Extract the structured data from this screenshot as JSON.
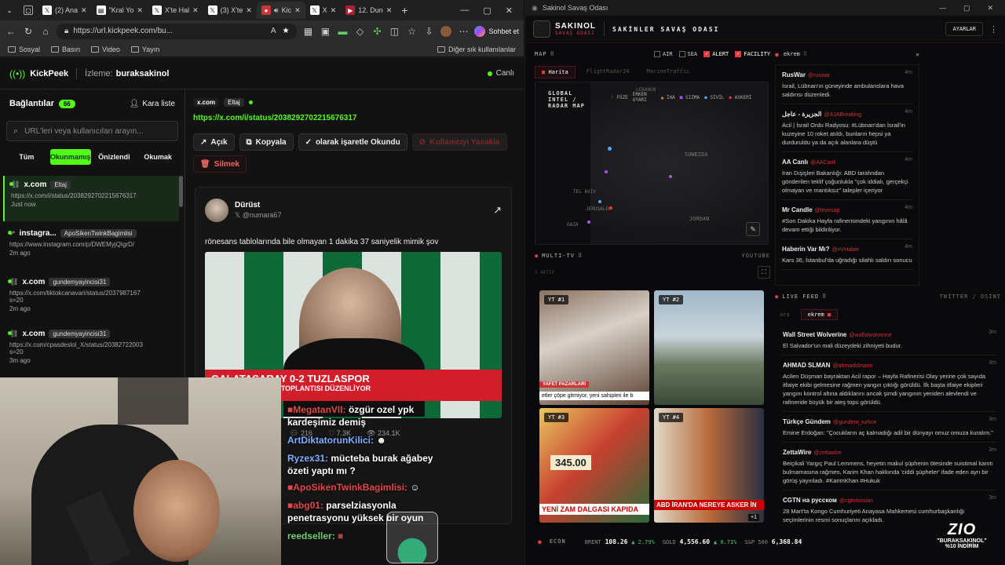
{
  "browser": {
    "tabs": [
      {
        "title": "",
        "icon": "chevron"
      },
      {
        "title": "",
        "icon": "tab-actions"
      },
      {
        "title": "(2) Ana",
        "icon": "x"
      },
      {
        "title": "\"Kral Yo",
        "icon": "page"
      },
      {
        "title": "X'te Hal",
        "icon": "x"
      },
      {
        "title": "(3) X'te",
        "icon": "x"
      },
      {
        "title": "Kic",
        "icon": "kick"
      },
      {
        "title": "X",
        "icon": "x"
      },
      {
        "title": "12. Dun",
        "icon": "media"
      }
    ],
    "url": "https://url.kickpeek.com/bu...",
    "chat_button": "Sohbet et",
    "bookmarks": [
      "Sosyal",
      "Basın",
      "Video",
      "Yayın"
    ],
    "other_bookmarks": "Diğer sık kullanılanlar"
  },
  "kickpeek": {
    "brand": "KickPeek",
    "watching_label": "İzleme:",
    "watching_user": "buraksakinol",
    "live": "Canlı",
    "connections_label": "Bağlantılar",
    "connections_count": "66",
    "blacklist": "Kara liste",
    "search_placeholder": "URL'leri veya kullanıcıları arayın...",
    "filters": [
      "Tüm",
      "Okunmamış",
      "Önizlendi",
      "Okumak"
    ],
    "active_filter": 1,
    "items": [
      {
        "site": "x.com",
        "user": "Eltaj",
        "url": "https://x.com/i/status/2038292702215676317",
        "time": "Just now"
      },
      {
        "site": "instagra...",
        "user": "ApoSikenTwinkBagimlisi",
        "url": "https://www.instagram.com/p/DWEMyjQIgrD/",
        "time": "2m ago"
      },
      {
        "site": "x.com",
        "user": "gundemyayincisi31",
        "url": "https://x.com/tiktokcanavari/status/2037987167\ns=20",
        "time": "2m ago"
      },
      {
        "site": "x.com",
        "user": "gundemyayincisi31",
        "url": "https://x.com/cpasdeslol_X/status/20382722003\ns=20",
        "time": "3m ago"
      }
    ],
    "detail": {
      "site": "x.com",
      "user": "Eltaj",
      "link": "https://x.com/i/status/2038292702215676317",
      "actions": [
        "Açık",
        "Kopyala",
        "olarak işaretle Okundu",
        "Kullanıcıyı Yasakla"
      ],
      "delete": "Silmek"
    },
    "tweet": {
      "name": "Dürüst",
      "handle": "@numara67",
      "text": "rönesans tablolarında bile olmayan 1 dakika 37 saniyelik mimik şov",
      "video_headline": "GALATASARAY 0-2 TUZLASPOR",
      "video_sub": "FATİH TERİM BASIN TOPLANTISI DÜZENLİYOR",
      "stats": [
        "216",
        "7.3K",
        "234.1K"
      ]
    }
  },
  "stream_chat": [
    {
      "user": "MegatanVII:",
      "text": "özgür ozel ypk kardeşimiz demiş",
      "color": "#e24848"
    },
    {
      "user": "ArtDiktatorunKilici:",
      "text": "",
      "color": "#7fb0ff"
    },
    {
      "user": "Ryzex31:",
      "text": "mücteba burak ağabey özeti yaptı mı ?",
      "color": "#7fb0ff"
    },
    {
      "user": "ApoSikenTwinkBagimlisi:",
      "text": "",
      "color": "#e24848"
    },
    {
      "user": "abg01:",
      "text": "parselziasyonla penetrasyonu yüksek bir oyun",
      "color": "#e24848"
    },
    {
      "user": "reedseller:",
      "text": "",
      "color": "#6ed06e"
    }
  ],
  "app": {
    "window_title": "Sakinol Savaş Odası",
    "logo_top": "SAKINOL",
    "logo_sub": "SAVAŞ ODASI",
    "header_title": "SAKİNLER SAVAŞ ODASI",
    "settings": "AYARLAR",
    "map": {
      "label": "MAP",
      "toggles": [
        {
          "label": "AIR",
          "checked": false
        },
        {
          "label": "SEA",
          "checked": false
        },
        {
          "label": "ALERT",
          "checked": true
        },
        {
          "label": "FACILITY",
          "checked": true
        }
      ],
      "tabs": [
        "Harita",
        "FlightRadar24",
        "MarineTraffic"
      ],
      "overlay_title": "GLOBAL\nINTEL /\nRADAR MAP",
      "legend": [
        "FÜZE",
        "ERKEN UYARI",
        "İHA",
        "SIZMA",
        "SİVİL",
        "ASKERİ"
      ],
      "places": [
        "LEBANON",
        "SUWEIDA",
        "TEL AVIV",
        "JERUSALEM",
        "GAZA",
        "JORDAN"
      ]
    },
    "twitter_box": {
      "tag": "ekrem",
      "items": [
        {
          "name": "RusWar",
          "handle": "@ruswar",
          "time": "4m",
          "text": "İsrail, Lübnan'ın güneyinde ambulanslara hava saldırısı düzenledi."
        },
        {
          "name": "الجزيرة - عاجل",
          "handle": "@AJABreaking",
          "time": "4m",
          "text": "Acil | İsrail Ordu Radyosu: #Lübnan'dan İsrail'in kuzeyine 10 roket atıldı, bunların hepsi ya durduruldu ya da açık alanlara düştü"
        },
        {
          "name": "AA Canlı",
          "handle": "@AACanli",
          "time": "4m",
          "text": "İran Dışişleri Bakanlığı: ABD tarafından gönderilen teklif çoğunlukla \"çok iddialı, gerçekçi olmayan ve mantıksız\" talepler içeriyor"
        },
        {
          "name": "Mr Candle",
          "handle": "@tevesap",
          "time": "4m",
          "text": "#Son Dakika Hayfa rafinerisindeki yangının hâlâ devam ettiği bildiriliyor."
        },
        {
          "name": "Haberin Var Mı?",
          "handle": "@nVHaber",
          "time": "4m",
          "text": "Kars 36, İstanbul'da uğradığı silahlı saldırı sonucu"
        }
      ]
    },
    "multitv": {
      "label": "MULTI-TV",
      "source": "YOUTUBE",
      "sub": "5 AKTIF",
      "tiles": [
        {
          "label": "YT #1",
          "caption": "YAFET PAZARLARI",
          "ticker": "etler çöpe gitmiyor, yeni sahipleri ile b"
        },
        {
          "label": "YT #2",
          "caption": "",
          "ticker": ""
        },
        {
          "label": "YT #3",
          "caption": "345.00",
          "ticker": "YENİ ZAM DALGASI KAPIDA"
        },
        {
          "label": "YT #4",
          "caption": "",
          "ticker": "ABD İRAN'DA NEREYE ASKER İN"
        }
      ],
      "more": "+1"
    },
    "live_feed": {
      "label": "LIVE FEED",
      "source": "TWITTER / OSINT",
      "search": "ara",
      "tag": "ekrem",
      "items": [
        {
          "name": "Wall Street Wolverine",
          "handle": "@wallstwolverine",
          "time": "3m",
          "text": "El Salvador'un mali düzeydeki zihniyeti budur."
        },
        {
          "name": "AHMAD SLMAN",
          "handle": "@ahmadslmann",
          "time": "3m",
          "text": "Acilen Düşman bayraktan Acil rapor – Hayfa Rafinerisi Olay yerine çok sayıda itfaiye ekibi gelmesine rağmen yangın çıktığı görüldü. İlk başta itfaiye ekipleri yangını kontrol altına aldıklarını ancak şimdi yangının yeniden alevlendi ve rafineride büyük bir ateş topu görüldü."
        },
        {
          "name": "Türkçe Gündem",
          "handle": "@gundem_turkce",
          "time": "3m",
          "text": "Emine Erdoğan: \"Çocukların aç kalmadığı adil bir dünyayı omuz omuza kuralım.\""
        },
        {
          "name": "ZettaWire",
          "handle": "@zettawire",
          "time": "3m",
          "text": "Beiçikali Yargıç Paul Lemmens, heyetin makul şüphenin ötesinde suistimal kanıtı bulmamasına rağmen, Karim Khan hakkında 'ciddi şüpheler' ifade eden ayrı bir görüş yayınladı. #KarimKhan #Hukuk"
        },
        {
          "name": "CGTN на русском",
          "handle": "@cgtnrussian",
          "time": "3m",
          "text": "28 Mart'ta Kongo Cumhuriyeti Anayasa Mahkemesi cumhurbaşkanlığı seçimlerinin resmi sonuçlarını açıkladı."
        }
      ]
    },
    "econ": {
      "label": "ECON",
      "items": [
        {
          "name": "BRENT",
          "value": "108.26",
          "change": "▲ 2.79%"
        },
        {
          "name": "GOLD",
          "value": "4,556.60",
          "change": "▲ 0.71%"
        },
        {
          "name": "S&P 500",
          "value": "6,368.84",
          "change": ""
        }
      ]
    },
    "promo": {
      "logo": "ZIO",
      "line1": "\"BURAKSAKINOL\"",
      "line2": "%10 İNDİRİM"
    }
  },
  "colors": {
    "accent_red": "#e23b45",
    "kick_green": "#53fc18",
    "link_green": "#4cc764"
  }
}
